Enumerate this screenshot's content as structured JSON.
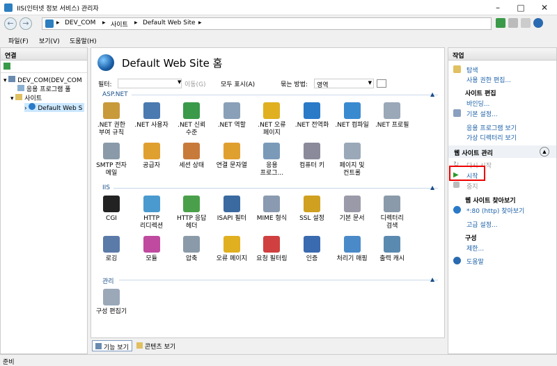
{
  "window": {
    "title": "IIS(인터넷 정보 서비스) 관리자"
  },
  "address": {
    "seg1": "DEV_COM",
    "seg2": "사이트",
    "seg3": "Default Web Site"
  },
  "menu": {
    "file": "파일(F)",
    "view": "보기(V)",
    "help": "도움말(H)"
  },
  "left": {
    "header": "연결",
    "tree": {
      "server": "DEV_COM(DEV_COM",
      "apppools": "응용 프로그램 풀",
      "sites": "사이트",
      "site": "Default Web S"
    }
  },
  "center": {
    "title": "Default Web Site 홈",
    "filter": {
      "label": "필터:",
      "go": "이동(G)",
      "showall": "모두 표시(A)",
      "groupby": "묶는 방법:",
      "groupval": "영역"
    },
    "groups": {
      "aspnet": "ASP.NET",
      "iis": "IIS",
      "mgmt": "관리"
    },
    "aspnet_row1": [
      {
        "l1": ".NET 권한",
        "l2": "부여 규칙",
        "color": "#c89a3a"
      },
      {
        "l1": ".NET 사용자",
        "l2": "",
        "color": "#4a7ab0"
      },
      {
        "l1": ".NET 신뢰",
        "l2": "수준",
        "color": "#3a9a4a"
      },
      {
        "l1": ".NET 역할",
        "l2": "",
        "color": "#8aa0b8"
      },
      {
        "l1": ".NET 오류",
        "l2": "페이지",
        "color": "#e0b020"
      },
      {
        "l1": ".NET 전역화",
        "l2": "",
        "color": "#2a7ac8"
      },
      {
        "l1": ".NET 컴파일",
        "l2": "",
        "color": "#3a8ad0"
      },
      {
        "l1": ".NET 프로필",
        "l2": "",
        "color": "#9aa8b8"
      }
    ],
    "aspnet_row2": [
      {
        "l1": "SMTP 전자",
        "l2": "메일",
        "color": "#8a9aa8"
      },
      {
        "l1": "공급자",
        "l2": "",
        "color": "#e0a030"
      },
      {
        "l1": "세션 상태",
        "l2": "",
        "color": "#c87a3a"
      },
      {
        "l1": "연결 문자열",
        "l2": "",
        "color": "#e0a030"
      },
      {
        "l1": "응용",
        "l2": "프로그...",
        "color": "#7a9ab8"
      },
      {
        "l1": "컴퓨터 키",
        "l2": "",
        "color": "#8a8a9a"
      },
      {
        "l1": "페이지 및",
        "l2": "컨트롤",
        "color": "#9aa8b8"
      }
    ],
    "iis_row1": [
      {
        "l1": "CGI",
        "l2": "",
        "color": "#222222"
      },
      {
        "l1": "HTTP",
        "l2": "리디렉션",
        "color": "#4a9ad0"
      },
      {
        "l1": "HTTP 응답",
        "l2": "헤더",
        "color": "#4aa04a"
      },
      {
        "l1": "ISAPI 필터",
        "l2": "",
        "color": "#3a6aa0"
      },
      {
        "l1": "MIME 형식",
        "l2": "",
        "color": "#8a9ab0"
      },
      {
        "l1": "SSL 설정",
        "l2": "",
        "color": "#d0a020"
      },
      {
        "l1": "기본 문서",
        "l2": "",
        "color": "#9a9aa8"
      },
      {
        "l1": "디렉터리",
        "l2": "검색",
        "color": "#8a9aaa"
      }
    ],
    "iis_row2": [
      {
        "l1": "로깅",
        "l2": "",
        "color": "#5a7aa8"
      },
      {
        "l1": "모듈",
        "l2": "",
        "color": "#c04aa0"
      },
      {
        "l1": "압축",
        "l2": "",
        "color": "#8a9aa8"
      },
      {
        "l1": "오류 페이지",
        "l2": "",
        "color": "#e0b020"
      },
      {
        "l1": "요청 필터링",
        "l2": "",
        "color": "#d04040"
      },
      {
        "l1": "인증",
        "l2": "",
        "color": "#3a6ab0"
      },
      {
        "l1": "처리기 매핑",
        "l2": "",
        "color": "#4a8ac8"
      },
      {
        "l1": "출력 캐시",
        "l2": "",
        "color": "#5a8ab0"
      }
    ],
    "mgmt_row1": [
      {
        "l1": "구성 편집기",
        "l2": "",
        "color": "#9aa8b8"
      }
    ]
  },
  "tabs": {
    "features": "기능 보기",
    "content": "콘텐츠 보기"
  },
  "right": {
    "header": "작업",
    "explore": "탐색",
    "perm": "사용 권한 편집...",
    "edit_site": "사이트 편집",
    "bindings": "바인딩...",
    "basic": "기본 설정...",
    "view_apps": "응용 프로그램 보기",
    "view_vdirs": "가상 디렉터리 보기",
    "manage_site": "웹 사이트 관리",
    "restart": "다시 시작",
    "start": "시작",
    "stop": "중지",
    "browse": "웹 사이트 찾아보기",
    "browse_link": "*:80 (http) 찾아보기",
    "advanced": "고급 설정...",
    "config": "구성",
    "limits": "제한...",
    "help": "도움말"
  },
  "status": "준비"
}
